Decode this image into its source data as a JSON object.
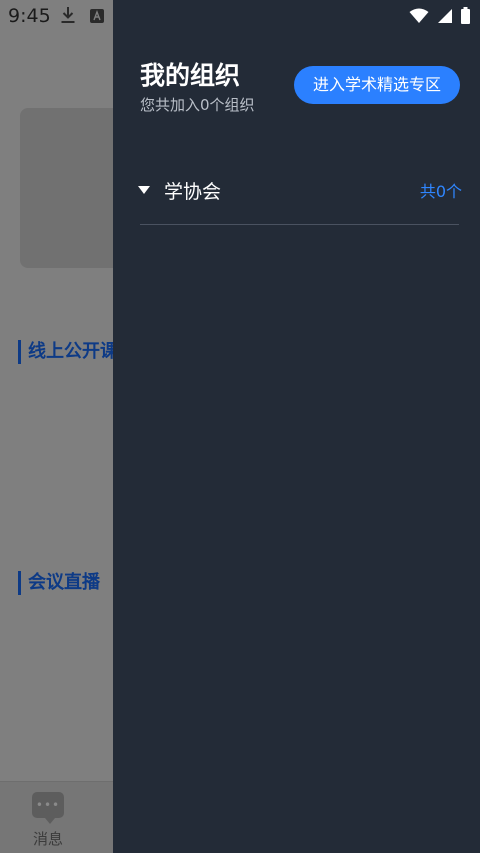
{
  "status_bar": {
    "time": "9:45",
    "icons_left": [
      "download-icon",
      "app-notification-icon"
    ],
    "icons_right": [
      "wifi-icon",
      "signal-icon",
      "battery-icon"
    ]
  },
  "background": {
    "sections": [
      "线上公开课",
      "会议直播"
    ],
    "bottom_tab": {
      "icon": "message-icon",
      "icon_text": "•••",
      "label": "消息"
    }
  },
  "drawer": {
    "title": "我的组织",
    "subtitle": "您共加入0个组织",
    "enter_button": "进入学术精选专区",
    "groups": [
      {
        "name": "学协会",
        "count": "共0个"
      }
    ]
  },
  "colors": {
    "drawer_bg": "#232b37",
    "accent": "#2b80ff",
    "count_text": "#2f86ff",
    "overlay": "#7f7f7f"
  }
}
